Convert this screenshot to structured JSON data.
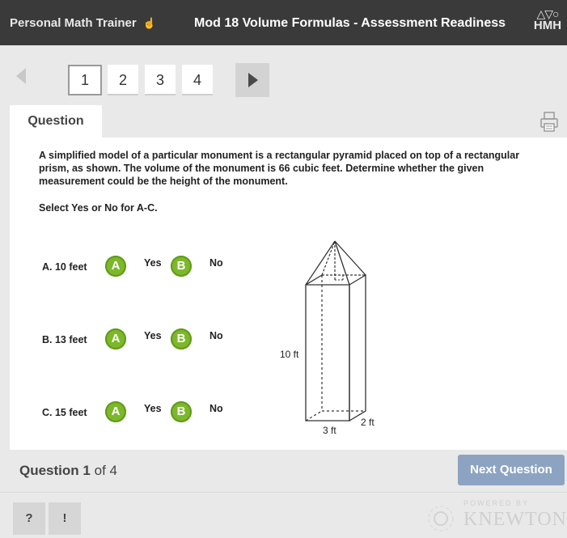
{
  "header": {
    "app_title": "Personal Math Trainer",
    "module_title": "Mod 18 Volume Formulas - Assessment Readiness",
    "logo_text": "HMH"
  },
  "nav": {
    "pages": [
      "1",
      "2",
      "3",
      "4"
    ],
    "active_page": "1"
  },
  "tabs": {
    "question": "Question"
  },
  "question": {
    "prompt": "A simplified model of a particular monument is a rectangular pyramid placed on top of a rectangular prism, as shown. The volume of the monument is 66 cubic feet. Determine whether the given measurement could be the height of the monument.",
    "instruction": "Select Yes or No for A-C.",
    "choices": [
      {
        "label": "A. 10 feet",
        "a": "A",
        "yes": "Yes",
        "b": "B",
        "no": "No"
      },
      {
        "label": "B. 13 feet",
        "a": "A",
        "yes": "Yes",
        "b": "B",
        "no": "No"
      },
      {
        "label": "C. 15 feet",
        "a": "A",
        "yes": "Yes",
        "b": "B",
        "no": "No"
      }
    ],
    "figure": {
      "height_label": "10 ft",
      "width_label": "3 ft",
      "depth_label": "2 ft"
    }
  },
  "footer": {
    "question_word": "Question",
    "current": "1",
    "of_total": "of 4",
    "next_label": "Next Question"
  },
  "bottom": {
    "help_label": "?",
    "alert_label": "!",
    "powered_by": "POWERED BY",
    "brand": "KNEWTON"
  },
  "colors": {
    "topbar": "#3a3a3a",
    "bubble_green": "#7db82a",
    "next_button": "#8da3c2"
  },
  "icons": {
    "printer": "printer-icon",
    "hand": "hand-pointer-icon"
  }
}
